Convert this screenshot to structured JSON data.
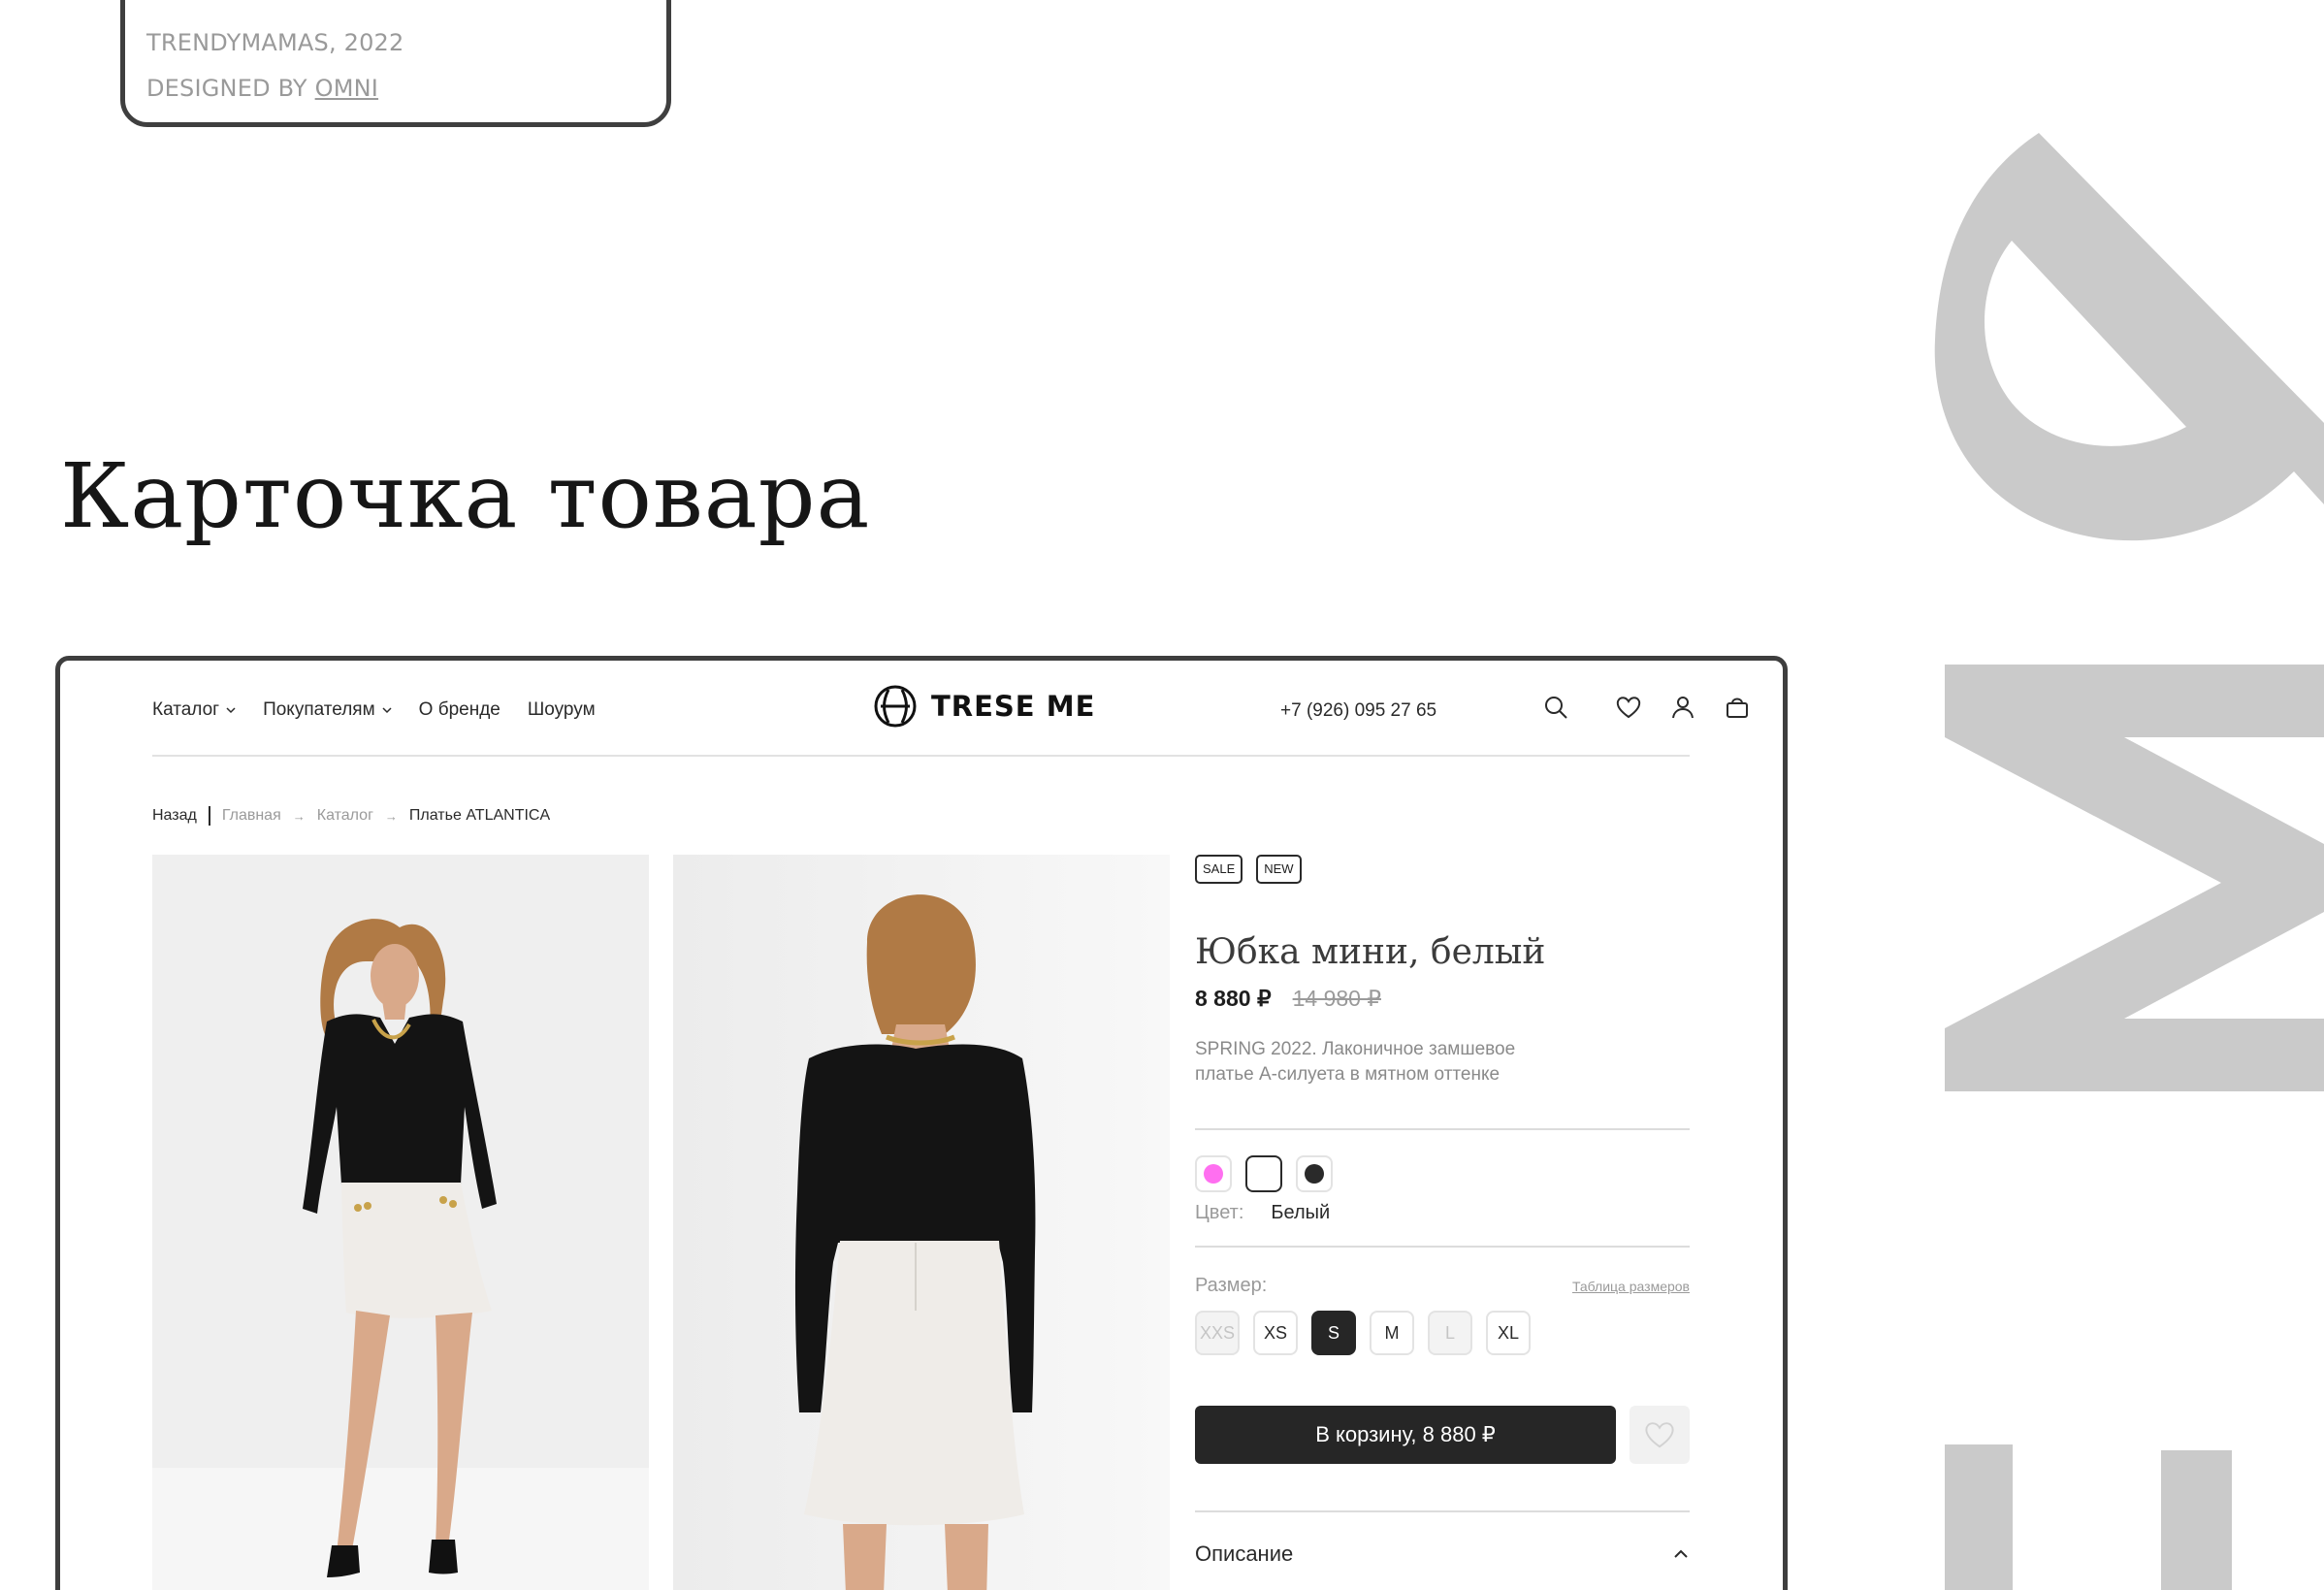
{
  "credits": {
    "line1": "TRENDYMAMAS, 2022",
    "line2_prefix": "DESIGNED BY ",
    "line2_link": "OMNI"
  },
  "section_title": "Карточка товара",
  "header": {
    "nav": [
      {
        "label": "Каталог",
        "has_dropdown": true
      },
      {
        "label": "Покупателям",
        "has_dropdown": true
      },
      {
        "label": "О бренде",
        "has_dropdown": false
      },
      {
        "label": "Шоурум",
        "has_dropdown": false
      }
    ],
    "logo_text": "TRESE ME",
    "phone": "+7 (926) 095 27 65",
    "icons": [
      "search-icon",
      "heart-icon",
      "user-icon",
      "bag-icon"
    ]
  },
  "breadcrumbs": {
    "back": "Назад",
    "items": [
      "Главная",
      "Каталог",
      "Платье ATLANTICA"
    ]
  },
  "product": {
    "badges": [
      "SALE",
      "NEW"
    ],
    "title": "Юбка мини, белый",
    "price": "8 880 ₽",
    "old_price": "14 980 ₽",
    "description": "SPRING 2022. Лаконичное замшевое платье А-силуета в мятном оттенке",
    "colors": [
      {
        "name": "pink",
        "hex": "#ff6ff0",
        "selected": false
      },
      {
        "name": "white",
        "hex": "#ffffff",
        "selected": true
      },
      {
        "name": "black",
        "hex": "#2a2a2a",
        "selected": false
      }
    ],
    "color_label": "Цвет:",
    "color_value": "Белый",
    "size_label": "Размер:",
    "size_table_link": "Таблица размеров",
    "sizes": [
      {
        "label": "XXS",
        "state": "unavailable"
      },
      {
        "label": "XS",
        "state": "available"
      },
      {
        "label": "S",
        "state": "selected"
      },
      {
        "label": "M",
        "state": "available"
      },
      {
        "label": "L",
        "state": "unavailable"
      },
      {
        "label": "XL",
        "state": "available"
      }
    ],
    "cart_button": "В корзину, 8 880 ₽",
    "accordion_label": "Описание"
  },
  "colors": {
    "deco_gray": "#cacaca",
    "dark": "#262626",
    "muted": "#9a9a9a"
  }
}
